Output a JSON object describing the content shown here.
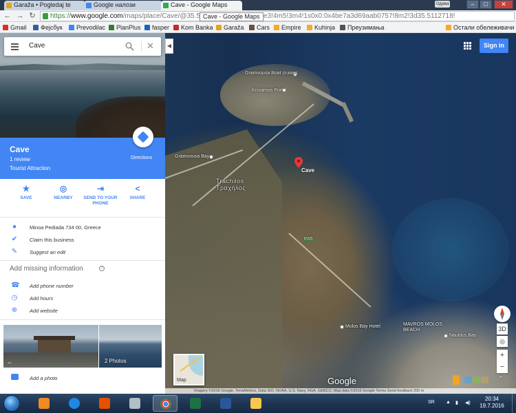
{
  "browser": {
    "tabs": [
      {
        "label": "Garaža • Pogledaj te",
        "color": "#e8a31c"
      },
      {
        "label": "Google налози",
        "color": "#4285f4"
      },
      {
        "label": "Cave - Google Maps",
        "color": "#34a853"
      }
    ],
    "user_badge": "Одјава",
    "url_https": "https://",
    "url_host": "www.google.com",
    "url_rest": "/maps/place/Cave/@35.5...830m/data=!3m1!1e3!4m5!3m4!1s0x0:0x4be7a3d69aab0757!8m2!3d35.5112718!",
    "tooltip": "Cave - Google Maps",
    "bookmarks": [
      {
        "label": "Gmail",
        "color": "#d93025"
      },
      {
        "label": "Фејсбук",
        "color": "#3b5998"
      },
      {
        "label": "Prevodilac",
        "color": "#4285f4"
      },
      {
        "label": "PlanPlus",
        "color": "#2e7d32"
      },
      {
        "label": "fasper",
        "color": "#1565c0"
      },
      {
        "label": "Kom Banka",
        "color": "#c62828"
      },
      {
        "label": "Garaža",
        "color": "#e8a31c"
      },
      {
        "label": "Cars",
        "color": "#6d4c41"
      },
      {
        "label": "Empire",
        "color": "#f9a825"
      },
      {
        "label": "Kuhinja",
        "color": "#f9a825"
      },
      {
        "label": "Преузимања",
        "color": "#555555"
      },
      {
        "label": "Остали обележивачи",
        "color": "#f9a825"
      }
    ]
  },
  "sidebar": {
    "search_value": "Cave",
    "place": {
      "name": "Cave",
      "reviews": "1 review",
      "type": "Tourist Attraction",
      "directions_label": "Directions"
    },
    "actions": [
      {
        "label": "SAVE",
        "icon": "★"
      },
      {
        "label": "NEARBY",
        "icon": "◎"
      },
      {
        "label": "SEND TO YOUR PHONE",
        "icon": "⇥"
      },
      {
        "label": "SHARE",
        "icon": "<"
      }
    ],
    "address": "Minoa Pediada 734 00, Greece",
    "claim": "Claim this business",
    "suggest": "Suggest an edit",
    "missing_title": "Add missing information",
    "missing": [
      {
        "label": "Add phone number",
        "icon": "☎"
      },
      {
        "label": "Add hours",
        "icon": "◷"
      },
      {
        "label": "Add website",
        "icon": "⊕"
      }
    ],
    "photo_count": "2 Photos",
    "add_photo": "Add a photo"
  },
  "map": {
    "signin_label": "Sign in",
    "minimap_label": "Map",
    "watermark": "Google",
    "footer": "Imagery ©2016 Google, TerraMetrics, Data SIO, NOAA, U.S. Navy, NGA, GEBCO, Map data ©2016 Google   Terms   Send feedback   200 m",
    "labels": {
      "gramvousa_boats": "Gramvousa Boat cruises",
      "kissamos_port": "Kissamos Port",
      "gramvousa_bay": "Gramvousa Bay",
      "trachilos_latin": "Trachilos",
      "trachilos_greek": "Τραχήλος",
      "cave": "Cave",
      "molos_bay_hotel": "Molos Bay Hotel",
      "mavros_molos": "MAVROS MOLOS BEACH",
      "nautilus_bay": "Nautilus Bay"
    },
    "road_number": "E65"
  },
  "taskbar": {
    "lang": "SR",
    "time": "20:34",
    "date": "19.7.2016"
  }
}
